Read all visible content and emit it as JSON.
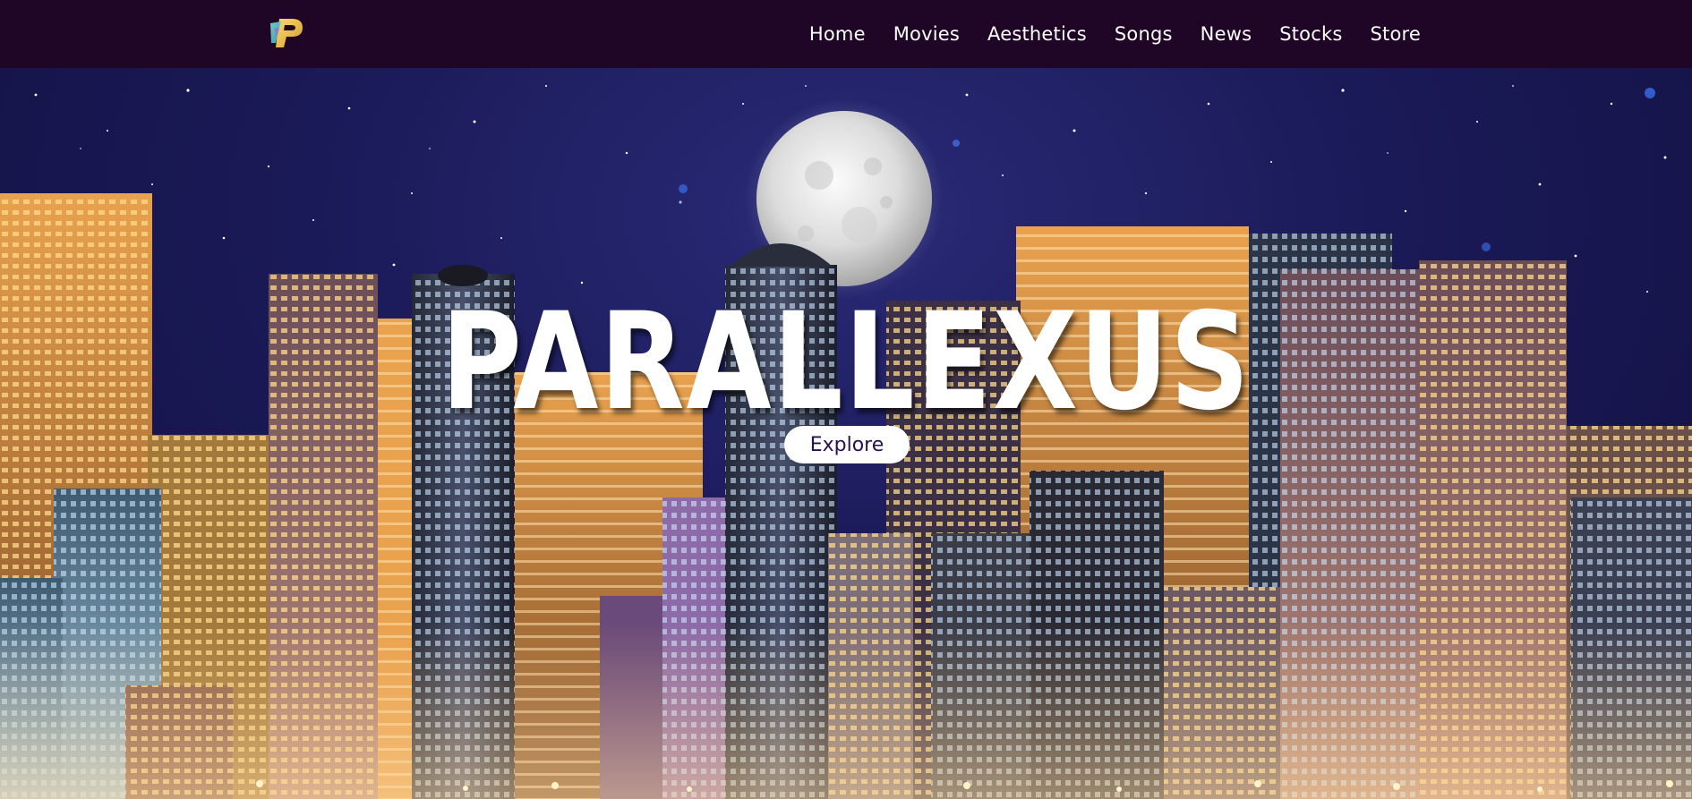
{
  "navbar": {
    "logo_letter": "P",
    "links": [
      {
        "label": "Home"
      },
      {
        "label": "Movies"
      },
      {
        "label": "Aesthetics"
      },
      {
        "label": "Songs"
      },
      {
        "label": "News"
      },
      {
        "label": "Stocks"
      },
      {
        "label": "Store"
      }
    ]
  },
  "hero": {
    "title": "PARALLEXUS",
    "button_label": "Explore"
  },
  "colors": {
    "navbar_bg": "#1f0526",
    "sky": "#1a1a58",
    "button_bg": "#ffffff",
    "button_text": "#2a1050",
    "logo_yellow": "#f2c94c",
    "logo_teal": "#56ccc2"
  },
  "icons": {
    "logo": "parallexus-logo-icon",
    "moon": "moon-image"
  }
}
